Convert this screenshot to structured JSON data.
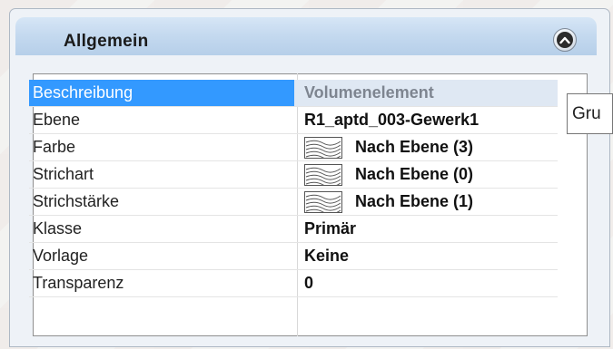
{
  "panel": {
    "title": "Allgemein",
    "collapse_icon": "chevron-up-circle-icon"
  },
  "properties": [
    {
      "label": "Beschreibung",
      "value": "Volumenelement",
      "selected": true,
      "dimmed": true
    },
    {
      "label": "Ebene",
      "value": "R1_aptd_003-Gewerk1"
    },
    {
      "label": "Farbe",
      "value": "Nach Ebene (3)",
      "icon": "hatch-pattern-icon"
    },
    {
      "label": "Strichart",
      "value": "Nach Ebene (0)",
      "icon": "hatch-pattern-icon"
    },
    {
      "label": "Strichstärke",
      "value": "Nach Ebene (1)",
      "icon": "hatch-pattern-icon"
    },
    {
      "label": "Klasse",
      "value": "Primär"
    },
    {
      "label": "Vorlage",
      "value": "Keine"
    },
    {
      "label": "Transparenz",
      "value": "0"
    }
  ],
  "tooltip": {
    "text": "Gru"
  },
  "colors": {
    "selection": "#3399ff",
    "header": "#c4d9ef"
  }
}
